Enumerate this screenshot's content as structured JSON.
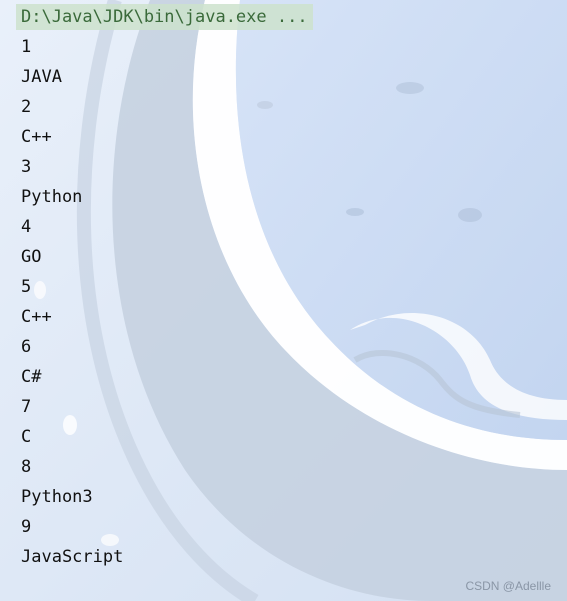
{
  "console": {
    "command": "D:\\Java\\JDK\\bin\\java.exe ...",
    "lines": [
      "1",
      "JAVA",
      "2",
      "C++",
      "3",
      "Python",
      "4",
      "GO",
      "5",
      "C++",
      "6",
      "C#",
      "7",
      "C",
      "8",
      "Python3",
      "9",
      "JavaScript"
    ]
  },
  "watermark": "CSDN @Adellle",
  "colors": {
    "background": "#dfe9f6",
    "command_highlight": "#cde2cd",
    "text": "#111111"
  }
}
